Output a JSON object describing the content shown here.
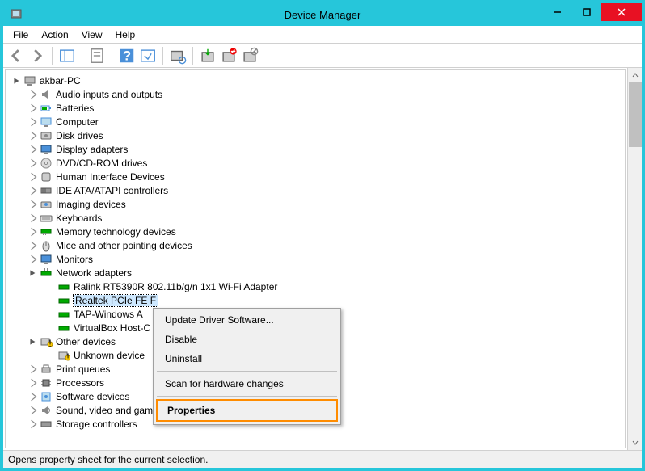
{
  "window": {
    "title": "Device Manager"
  },
  "menu": {
    "file": "File",
    "action": "Action",
    "view": "View",
    "help": "Help"
  },
  "tree": {
    "root": "akbar-PC",
    "nodes": [
      "Audio inputs and outputs",
      "Batteries",
      "Computer",
      "Disk drives",
      "Display adapters",
      "DVD/CD-ROM drives",
      "Human Interface Devices",
      "IDE ATA/ATAPI controllers",
      "Imaging devices",
      "Keyboards",
      "Memory technology devices",
      "Mice and other pointing devices",
      "Monitors"
    ],
    "network": {
      "label": "Network adapters",
      "children": [
        "Ralink RT5390R 802.11b/g/n 1x1 Wi-Fi Adapter",
        "Realtek PCIe FE F",
        "TAP-Windows A",
        "VirtualBox Host-C"
      ]
    },
    "other_devices": {
      "label": "Other devices",
      "children": [
        "Unknown device"
      ]
    },
    "after": [
      "Print queues",
      "Processors",
      "Software devices",
      "Sound, video and game controllers",
      "Storage controllers"
    ]
  },
  "context_menu": {
    "update": "Update Driver Software...",
    "disable": "Disable",
    "uninstall": "Uninstall",
    "scan": "Scan for hardware changes",
    "properties": "Properties"
  },
  "statusbar": {
    "text": "Opens property sheet for the current selection."
  }
}
